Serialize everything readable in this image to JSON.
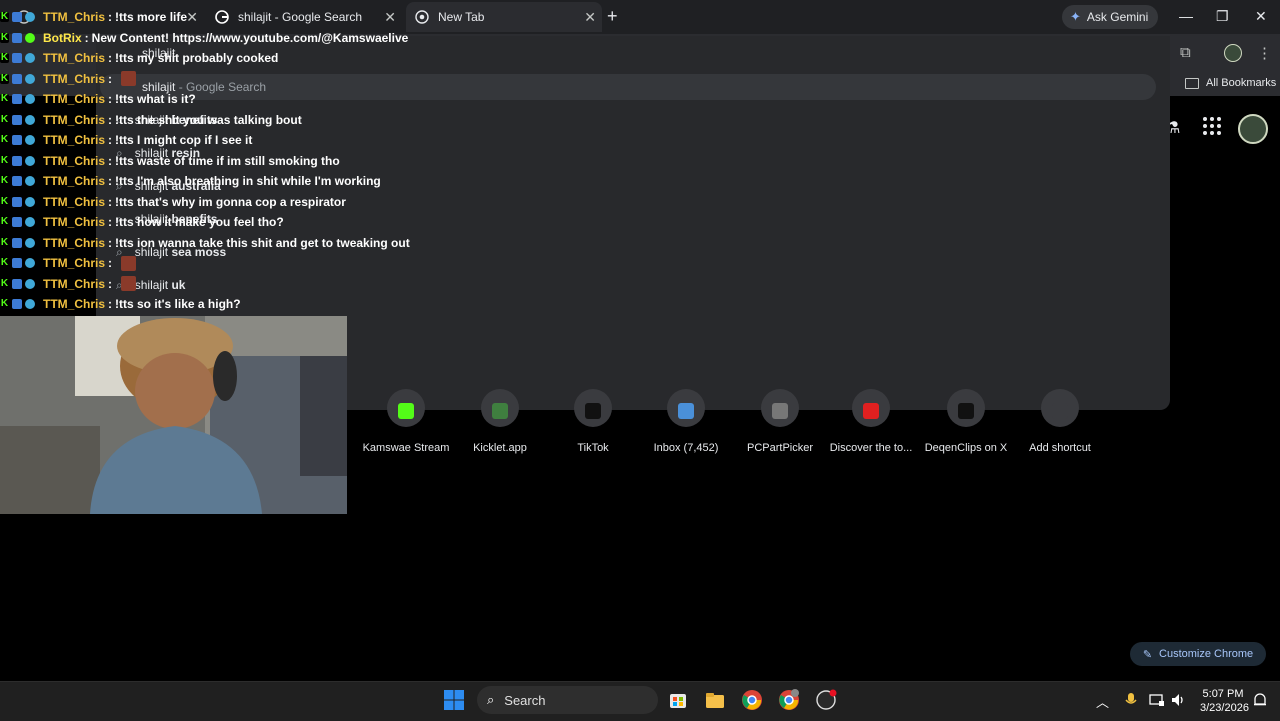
{
  "browser": {
    "tabs": [
      {
        "title": "",
        "active": false
      },
      {
        "title": "shilajit - Google Search",
        "active": false
      },
      {
        "title": "New Tab",
        "active": true
      }
    ],
    "ask_gemini": "Ask Gemini",
    "all_bookmarks": "All Bookmarks"
  },
  "omnibox": {
    "input_value": "shilajit",
    "suggestions": [
      {
        "query": "shilajit",
        "suffix": "",
        "detail": "- Google Search"
      },
      {
        "query": "shilajit",
        "suffix": "benefits",
        "detail": ""
      },
      {
        "query": "shilajit",
        "suffix": "resin",
        "detail": ""
      },
      {
        "query": "shilajit",
        "suffix": "australia",
        "detail": ""
      },
      {
        "query": "shilajit",
        "suffix": "benefits",
        "detail": ""
      },
      {
        "query": "shilajit",
        "suffix": "sea moss",
        "detail": ""
      },
      {
        "query": "shilajit",
        "suffix": "uk",
        "detail": ""
      }
    ]
  },
  "shortcuts": [
    {
      "label": "Kamswae Stream",
      "icon": "kick-icon",
      "color": "#53fc18"
    },
    {
      "label": "Kicklet.app",
      "icon": "kicklet-icon",
      "color": "#3f7f3f"
    },
    {
      "label": "TikTok",
      "icon": "tiktok-icon",
      "color": "#111111"
    },
    {
      "label": "Inbox (7,452)",
      "icon": "gmail-icon",
      "color": "#4a90d9"
    },
    {
      "label": "PCPartPicker",
      "icon": "pcpartpicker-icon",
      "color": "#777777"
    },
    {
      "label": "Discover the to...",
      "icon": "youtube-icon",
      "color": "#e02020"
    },
    {
      "label": "DeqenClips on X",
      "icon": "x-icon",
      "color": "#111111"
    },
    {
      "label": "Add shortcut",
      "icon": "plus-icon",
      "color": "#3a3b3f"
    }
  ],
  "customize_chrome": "Customize Chrome",
  "chat": {
    "lines": [
      {
        "user": "TTM_Chris",
        "text": "!tts more life",
        "emote": false
      },
      {
        "user": "BotRix",
        "text": "New Content! https://www.youtube.com/@Kamswaelive",
        "emote": false
      },
      {
        "user": "TTM_Chris",
        "text": "!tts my shit probably cooked",
        "emote": false
      },
      {
        "user": "TTM_Chris",
        "text": "",
        "emote": true
      },
      {
        "user": "TTM_Chris",
        "text": "!tts what is it?",
        "emote": false
      },
      {
        "user": "TTM_Chris",
        "text": "!tts the shit you was talking bout",
        "emote": false
      },
      {
        "user": "TTM_Chris",
        "text": "!tts I might cop if I see it",
        "emote": false
      },
      {
        "user": "TTM_Chris",
        "text": "!tts waste of time if im still smoking tho",
        "emote": false
      },
      {
        "user": "TTM_Chris",
        "text": "!tts I'm also breathing in shit while I'm working",
        "emote": false
      },
      {
        "user": "TTM_Chris",
        "text": "!tts that's why im gonna cop a respirator",
        "emote": false
      },
      {
        "user": "TTM_Chris",
        "text": "!tts how it make you feel tho?",
        "emote": false
      },
      {
        "user": "TTM_Chris",
        "text": "!tts ion wanna take this shit and get to tweaking out",
        "emote": false
      },
      {
        "user": "TTM_Chris",
        "text": "",
        "emote": true
      },
      {
        "user": "TTM_Chris",
        "text": "",
        "emote": true
      },
      {
        "user": "TTM_Chris",
        "text": "!tts so it's like a high?",
        "emote": false
      }
    ]
  },
  "taskbar": {
    "search_placeholder": "Search",
    "time": "5:07 PM",
    "date": "3/23/2026"
  }
}
